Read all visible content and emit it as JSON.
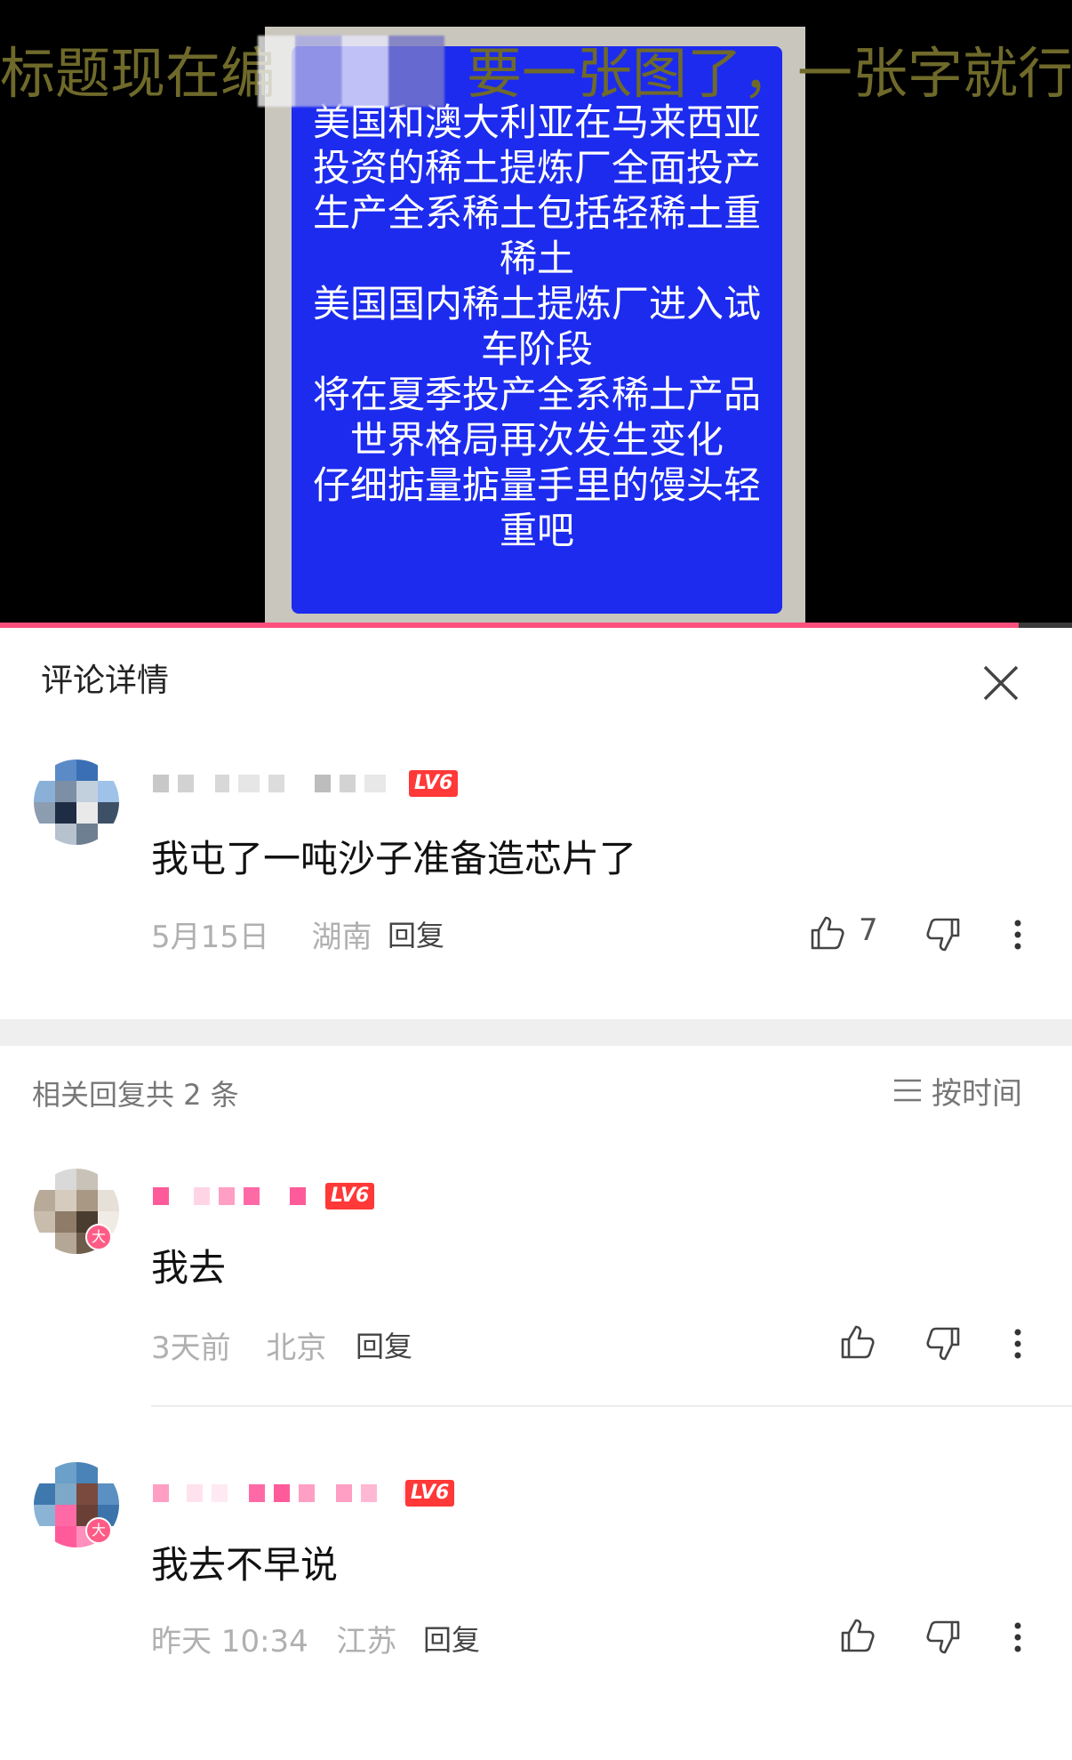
{
  "video": {
    "caption": "标题现在编",
    "caption_tail": "要一张图了，一张字就行了何",
    "screen_lines": [
      "美国和澳大利亚在马来西亚",
      "投资的稀土提炼厂全面投产",
      "生产全系稀土包括轻稀土重",
      "稀土",
      "美国国内稀土提炼厂进入试",
      "车阶段",
      "将在夏季投产全系稀土产品",
      "世界格局再次发生变化",
      "仔细掂量掂量手里的馒头轻",
      "重吧"
    ],
    "progress": 0.95
  },
  "panel": {
    "title": "评论详情",
    "close_icon": "close-icon"
  },
  "main_comment": {
    "level": "LV6",
    "text": "我屯了一吨沙子准备造芯片了",
    "date": "5月15日",
    "location": "湖南",
    "reply_label": "回复",
    "likes": "7"
  },
  "replies_header": {
    "count_text": "相关回复共 2 条",
    "sort_label": "按时间"
  },
  "replies": [
    {
      "level": "LV6",
      "text": "我去",
      "date": "3天前",
      "location": "北京",
      "reply_label": "回复"
    },
    {
      "level": "LV6",
      "text": "我去不早说",
      "date": "昨天 10:34",
      "location": "江苏",
      "reply_label": "回复"
    }
  ],
  "colors": {
    "accent": "#ff4f7d",
    "level_badge": "#ff3838",
    "blue_screen": "#1c2bee"
  }
}
